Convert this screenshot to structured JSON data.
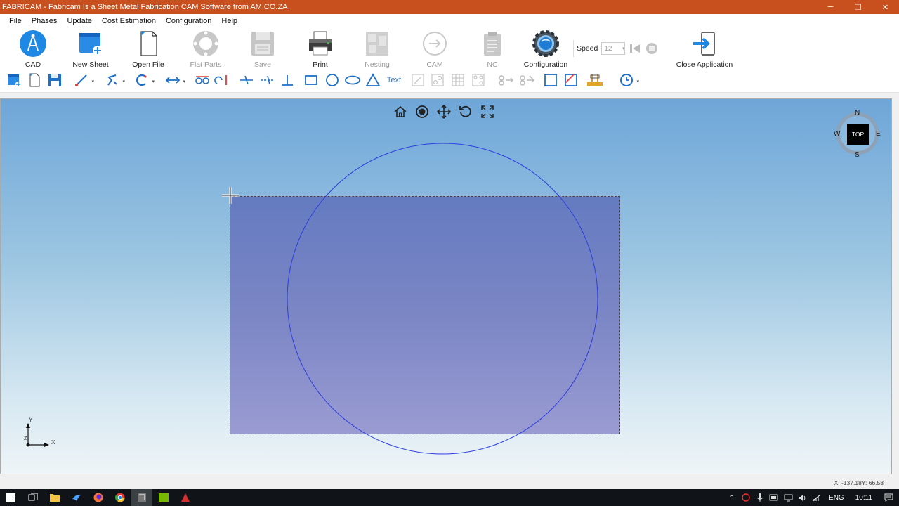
{
  "window": {
    "title": "FABRICAM - Fabricam Is a Sheet Metal Fabrication CAM Software from AM.CO.ZA",
    "minimize_glyph": "─",
    "restore_glyph": "❐",
    "close_glyph": "✕"
  },
  "menu": {
    "items": [
      "File",
      "Phases",
      "Update",
      "Cost Estimation",
      "Configuration",
      "Help"
    ]
  },
  "ribbon": {
    "buttons": [
      {
        "label": "CAD",
        "icon": "cad-compass-icon",
        "enabled": true
      },
      {
        "label": "New Sheet",
        "icon": "new-sheet-icon",
        "enabled": true
      },
      {
        "label": "Open File",
        "icon": "open-file-icon",
        "enabled": true
      },
      {
        "label": "Flat Parts",
        "icon": "flat-parts-icon",
        "enabled": false
      },
      {
        "label": "Save",
        "icon": "save-icon",
        "enabled": false
      },
      {
        "label": "Print",
        "icon": "printer-icon",
        "enabled": true
      },
      {
        "label": "Nesting",
        "icon": "nesting-icon",
        "enabled": false
      },
      {
        "label": "CAM",
        "icon": "cam-arrow-icon",
        "enabled": false
      },
      {
        "label": "NC",
        "icon": "nc-clipboard-icon",
        "enabled": false
      },
      {
        "label": "Configuration",
        "icon": "gear-icon",
        "enabled": true
      },
      {
        "label": "Close Application",
        "icon": "exit-icon",
        "enabled": true
      }
    ],
    "speed": {
      "label": "Speed",
      "value": "12"
    }
  },
  "tools": {
    "text_label": "Text"
  },
  "canvas": {
    "compass": {
      "center_label": "TOP",
      "n": "N",
      "s": "S",
      "e": "E",
      "w": "W"
    },
    "axes": {
      "x": "X",
      "y": "Y",
      "z": "Z"
    }
  },
  "status": {
    "coordinates": "X: -137.18Y: 66.58"
  },
  "taskbar": {
    "language": "ENG",
    "time": "10:11"
  }
}
